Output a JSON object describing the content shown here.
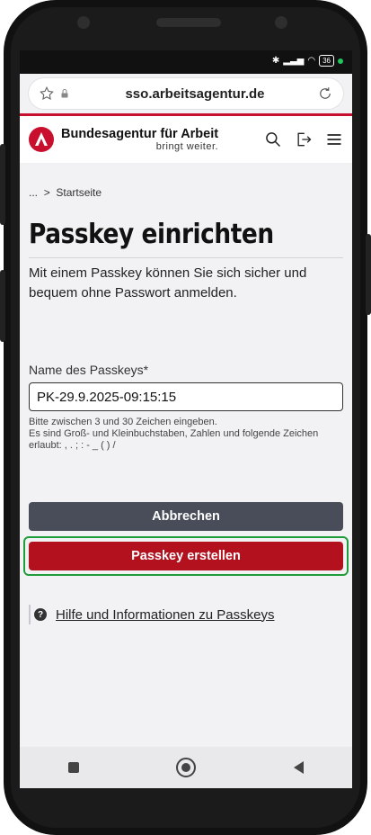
{
  "browser": {
    "url": "sso.arbeitsagentur.de"
  },
  "status": {
    "battery": "36"
  },
  "header": {
    "brand_name": "Bundesagentur für Arbeit",
    "brand_tagline": "bringt weiter."
  },
  "breadcrumb": {
    "ellipsis": "...",
    "separator": ">",
    "current": "Startseite"
  },
  "page": {
    "title": "Passkey einrichten",
    "intro": "Mit einem Passkey können Sie sich sicher und bequem ohne Passwort anmelden."
  },
  "form": {
    "label": "Name des Passkeys*",
    "value": "PK-29.9.2025-09:15:15",
    "hint_line1": "Bitte zwischen 3 und 30 Zeichen eingeben.",
    "hint_line2": "Es sind Groß- und Kleinbuchstaben, Zahlen und folgende Zeichen erlaubt: , . ; : - _ ( ) /"
  },
  "actions": {
    "cancel": "Abbrechen",
    "create": "Passkey erstellen"
  },
  "help": {
    "icon": "?",
    "link": "Hilfe und Informationen zu Passkeys"
  },
  "colors": {
    "brand_red": "#c8102e",
    "create_button": "#b3111e",
    "cancel_button": "#484d59",
    "highlight": "#1f9d3a"
  }
}
